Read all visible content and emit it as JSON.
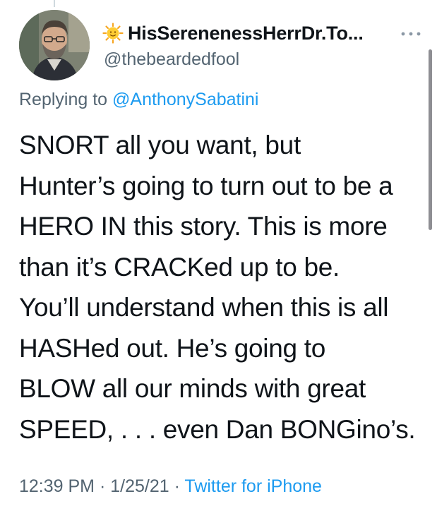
{
  "user": {
    "display_name": "HisSerenenessHerrDr.To...",
    "handle": "@thebeardedfool",
    "name_emoji": "sun-with-face-icon",
    "avatar": "bearded-man-with-glasses-avatar"
  },
  "reply": {
    "prefix": "Replying to ",
    "target": "@AnthonySabatini"
  },
  "tweet": {
    "lines": [
      "SNORT all you want, but",
      "Hunter’s going to turn out to be a",
      "HERO IN this story.  This is more",
      "than it’s CRACKed up to be.",
      "You’ll understand when this is all",
      "HASHed out. He’s going to",
      "BLOW all our minds with great",
      "SPEED, . . . even Dan BONGino’s."
    ]
  },
  "meta": {
    "time": "12:39 PM",
    "separator": " · ",
    "date": "1/25/21",
    "source": "Twitter for iPhone"
  },
  "colors": {
    "link": "#1d9bf0",
    "secondary_text": "#536471",
    "primary_text": "#0f1419"
  }
}
